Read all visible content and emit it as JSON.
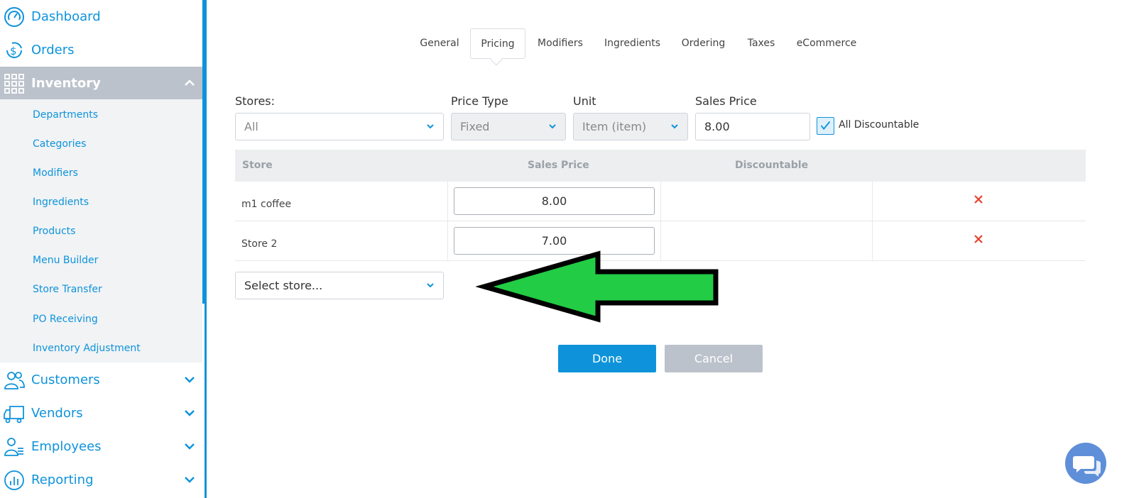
{
  "sidebar": {
    "top_items": [
      {
        "label": "Dashboard",
        "icon": "speedometer-icon"
      },
      {
        "label": "Orders",
        "icon": "dollar-refresh-icon"
      },
      {
        "label": "Inventory",
        "icon": "grid-icon",
        "active": true
      }
    ],
    "submenu": [
      "Departments",
      "Categories",
      "Modifiers",
      "Ingredients",
      "Products",
      "Menu Builder",
      "Store Transfer",
      "PO Receiving",
      "Inventory Adjustment"
    ],
    "bottom_items": [
      {
        "label": "Customers",
        "icon": "users-icon"
      },
      {
        "label": "Vendors",
        "icon": "truck-icon"
      },
      {
        "label": "Employees",
        "icon": "employees-icon"
      },
      {
        "label": "Reporting",
        "icon": "chart-icon"
      }
    ]
  },
  "tabs": [
    "General",
    "Pricing",
    "Modifiers",
    "Ingredients",
    "Ordering",
    "Taxes",
    "eCommerce"
  ],
  "active_tab": "Pricing",
  "form": {
    "stores_label": "Stores:",
    "stores_value": "All",
    "price_type_label": "Price Type",
    "price_type_value": "Fixed",
    "unit_label": "Unit",
    "unit_value": "Item (item)",
    "sales_price_label": "Sales Price",
    "sales_price_value": "8.00",
    "all_discountable_label": "All Discountable",
    "all_discountable_checked": true
  },
  "table": {
    "headers": [
      "Store",
      "Sales Price",
      "Discountable"
    ],
    "rows": [
      {
        "store": "m1 coffee",
        "price": "8.00"
      },
      {
        "store": "Store 2",
        "price": "7.00"
      }
    ]
  },
  "select_store_placeholder": "Select store...",
  "buttons": {
    "done": "Done",
    "cancel": "Cancel"
  },
  "colors": {
    "accent": "#0e93db",
    "sidebar_active": "#bcc2cb",
    "delete": "#e8412c",
    "arrow": "#22cc44",
    "chat": "#5f8fd8"
  }
}
